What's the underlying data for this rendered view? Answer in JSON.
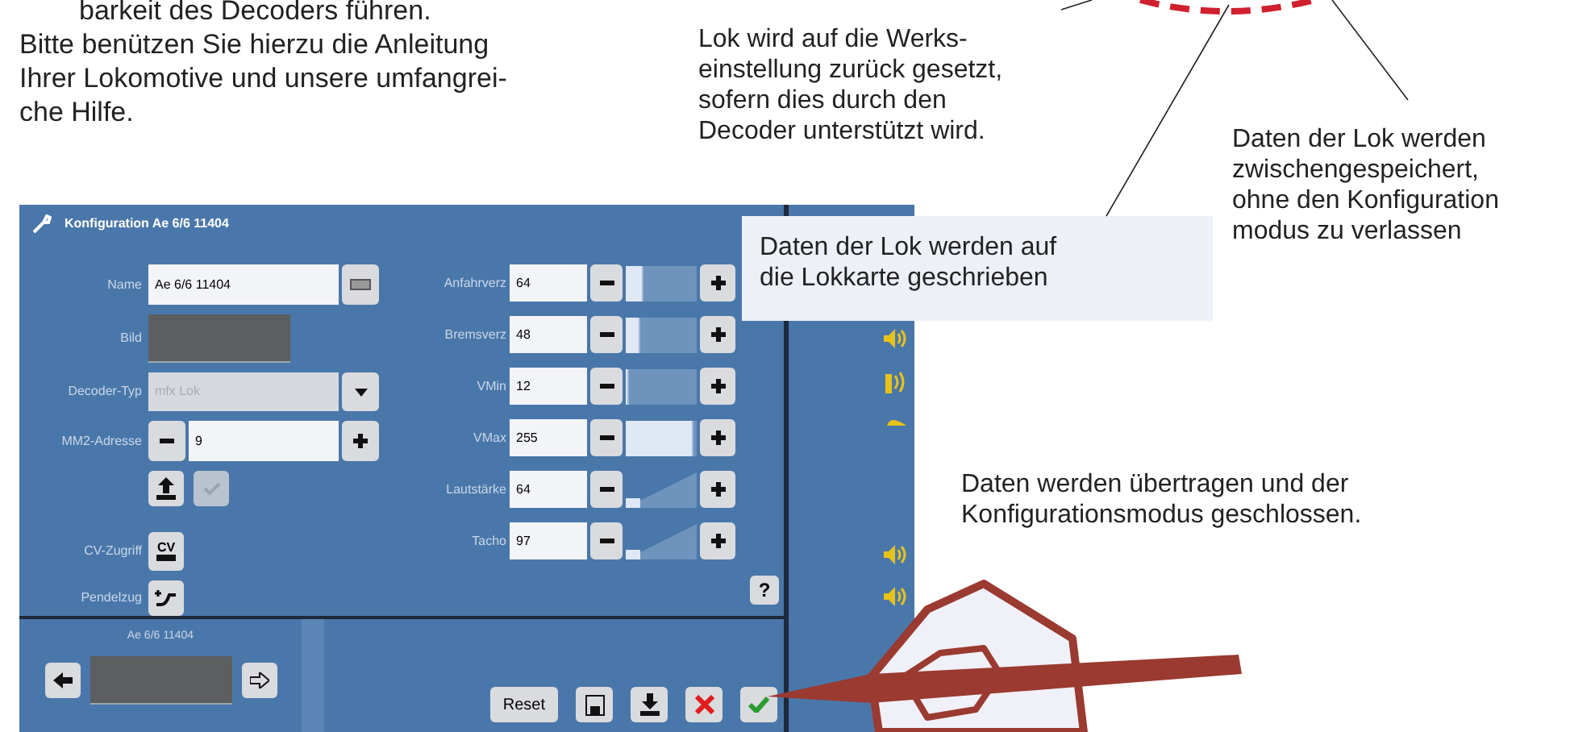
{
  "intro_cut_line": "barkeit des Decoders führen.",
  "intro_paragraph": [
    "Bitte benützen Sie hierzu die Anleitung",
    "Ihrer Lokomotive und unsere umfangrei-",
    "che Hilfe."
  ],
  "callouts": [
    {
      "kind": "plain",
      "lines": [
        "Lok wird auf die Werks-",
        "einstellung zurück gesetzt,",
        "sofern dies durch den",
        "Decoder unterstützt wird."
      ]
    },
    {
      "kind": "boxed",
      "lines": [
        "Daten der Lok werden auf",
        "die Lokkarte geschrieben"
      ]
    },
    {
      "kind": "plain",
      "lines": [
        "Daten der Lok werden",
        "zwischengespeichert,",
        "ohne den Konfiguration",
        "modus zu verlassen"
      ]
    },
    {
      "kind": "plain",
      "lines": [
        "Daten werden übertragen und der",
        "Konfigurationsmodus geschlossen."
      ]
    }
  ],
  "screen": {
    "title": "Konfiguration Ae 6/6 11404",
    "name_field": {
      "label": "Name",
      "value": "Ae 6/6 11404"
    },
    "picture": {
      "label": "Bild"
    },
    "decoder_type": {
      "label": "Decoder-Typ",
      "value": "mfx Lok",
      "disabled": true
    },
    "mm2_address": {
      "label": "MM2-Adresse",
      "value": "9"
    },
    "confirm_button": {
      "disabled": true
    },
    "cv_access": {
      "label": "CV-Zugriff",
      "icon_text": "CV"
    },
    "shuttle": {
      "label": "Pendelzug"
    },
    "settings": [
      {
        "label": "Anfahrverz",
        "value": "64",
        "kind": "bar",
        "level": 0.25
      },
      {
        "label": "Bremsverz",
        "value": "48",
        "kind": "bar",
        "level": 0.2
      },
      {
        "label": "VMin",
        "value": "12",
        "kind": "bar",
        "level": 0.05
      },
      {
        "label": "VMax",
        "value": "255",
        "kind": "bar",
        "level": 0.95
      },
      {
        "label": "Lautstärke",
        "value": "64",
        "kind": "ramp",
        "level": 0.2
      },
      {
        "label": "Tacho",
        "value": "97",
        "kind": "ramp",
        "level": 0.2
      }
    ],
    "help": "?",
    "loco_name": "Ae 6/6 11404",
    "buttons": [
      {
        "kind": "text",
        "label": "Reset"
      },
      {
        "kind": "save"
      },
      {
        "kind": "write-card"
      },
      {
        "kind": "cancel"
      },
      {
        "kind": "accept"
      }
    ]
  }
}
